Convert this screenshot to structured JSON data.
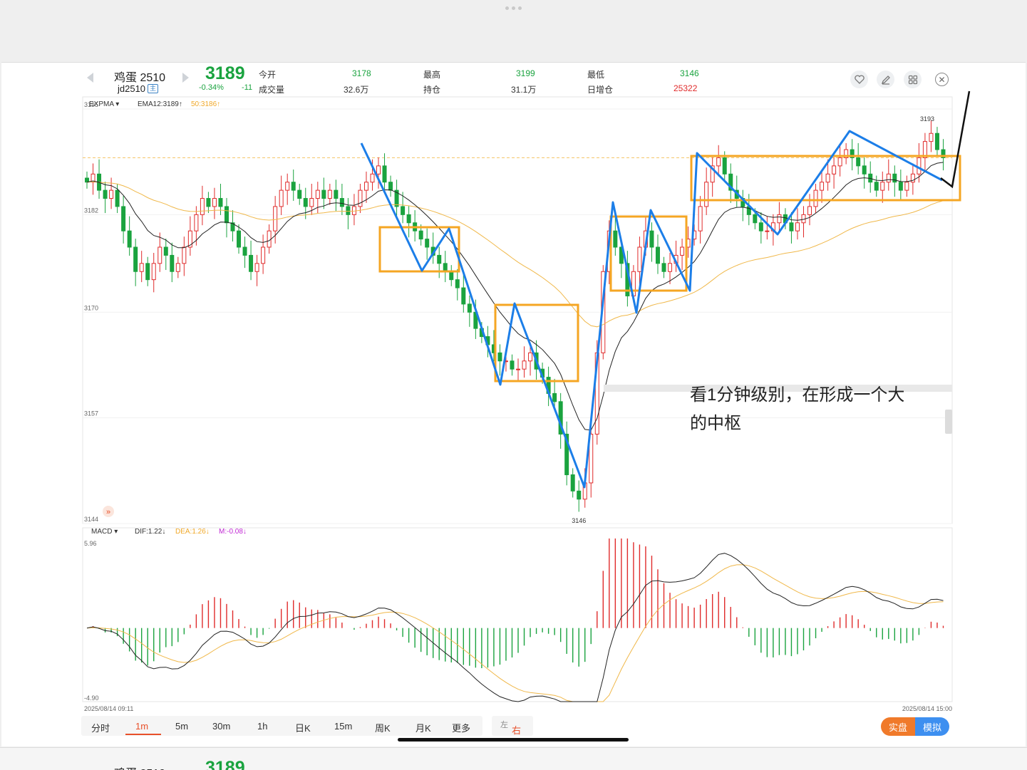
{
  "header": {
    "name": "鸡蛋 2510",
    "code": "jd2510",
    "main_badge": "主",
    "price": "3189",
    "change_pct": "-0.34%",
    "change": "-11",
    "stats": [
      {
        "label": "今开",
        "value": "3178",
        "color": "green"
      },
      {
        "label": "成交量",
        "value": "32.6万",
        "color": "dark"
      },
      {
        "label": "最高",
        "value": "3199",
        "color": "green"
      },
      {
        "label": "持仓",
        "value": "31.1万",
        "color": "dark"
      },
      {
        "label": "最低",
        "value": "3146",
        "color": "green"
      },
      {
        "label": "日增仓",
        "value": "25322",
        "color": "red"
      }
    ],
    "icons": [
      "heart-icon",
      "edit-icon",
      "grid-icon",
      "close-icon"
    ]
  },
  "indicators": {
    "main": {
      "name": "EXPMA",
      "ema12": "EMA12:3189↑",
      "ema50": "50:3186↑"
    },
    "sub": {
      "name": "MACD",
      "dif": "DIF:1.22↓",
      "dea": "DEA:1.26↓",
      "m": "M:-0.08↓"
    }
  },
  "axis": {
    "price_ticks": [
      "3195",
      "3182",
      "3170",
      "3157",
      "3144"
    ],
    "macd_ticks": [
      "5.96",
      "-4.90"
    ],
    "high_label": "3193",
    "low_label": "3146",
    "time_start": "2025/08/14 09:11",
    "time_end": "2025/08/14 15:00"
  },
  "annotation": "看1分钟级别，在形成一个大的中枢",
  "toolbar": {
    "periods": [
      "分时",
      "1m",
      "5m",
      "30m",
      "1h",
      "日K",
      "15m",
      "周K",
      "月K",
      "更多"
    ],
    "active": "1m",
    "left_right": {
      "left": "左",
      "right": "右"
    },
    "mode_real": "实盘",
    "mode_sim": "模拟"
  },
  "chart_data": {
    "type": "candlestick",
    "title": "",
    "ylim": [
      3144,
      3195
    ],
    "macd_ylim": [
      -4.9,
      5.96
    ],
    "close": [
      3186,
      3187,
      3185,
      3184,
      3185,
      3183,
      3180,
      3178,
      3175,
      3176,
      3174,
      3176,
      3178,
      3177,
      3175,
      3176,
      3178,
      3180,
      3182,
      3184,
      3183,
      3184,
      3183,
      3181,
      3180,
      3178,
      3177,
      3175,
      3176,
      3178,
      3180,
      3183,
      3185,
      3186,
      3185,
      3184,
      3183,
      3184,
      3185,
      3184,
      3185,
      3184,
      3183,
      3182,
      3183,
      3185,
      3186,
      3187,
      3188,
      3186,
      3185,
      3183,
      3182,
      3181,
      3180,
      3179,
      3178,
      3177,
      3176,
      3175,
      3174,
      3173,
      3171,
      3170,
      3168,
      3167,
      3166,
      3165,
      3164,
      3164,
      3163,
      3163,
      3164,
      3165,
      3163,
      3162,
      3160,
      3159,
      3155,
      3150,
      3148,
      3147,
      3149,
      3155,
      3165,
      3175,
      3180,
      3178,
      3176,
      3172,
      3175,
      3178,
      3180,
      3178,
      3176,
      3175,
      3176,
      3177,
      3178,
      3179,
      3180,
      3183,
      3186,
      3188,
      3189,
      3187,
      3185,
      3184,
      3183,
      3182,
      3181,
      3180,
      3180,
      3181,
      3182,
      3181,
      3180,
      3181,
      3182,
      3183,
      3185,
      3186,
      3187,
      3188,
      3189,
      3190,
      3189,
      3188,
      3187,
      3186,
      3185,
      3186,
      3187,
      3186,
      3185,
      3186,
      3187,
      3189,
      3191,
      3192,
      3190,
      3189
    ],
    "ema12_last": 3189,
    "ema50_last": 3186
  }
}
